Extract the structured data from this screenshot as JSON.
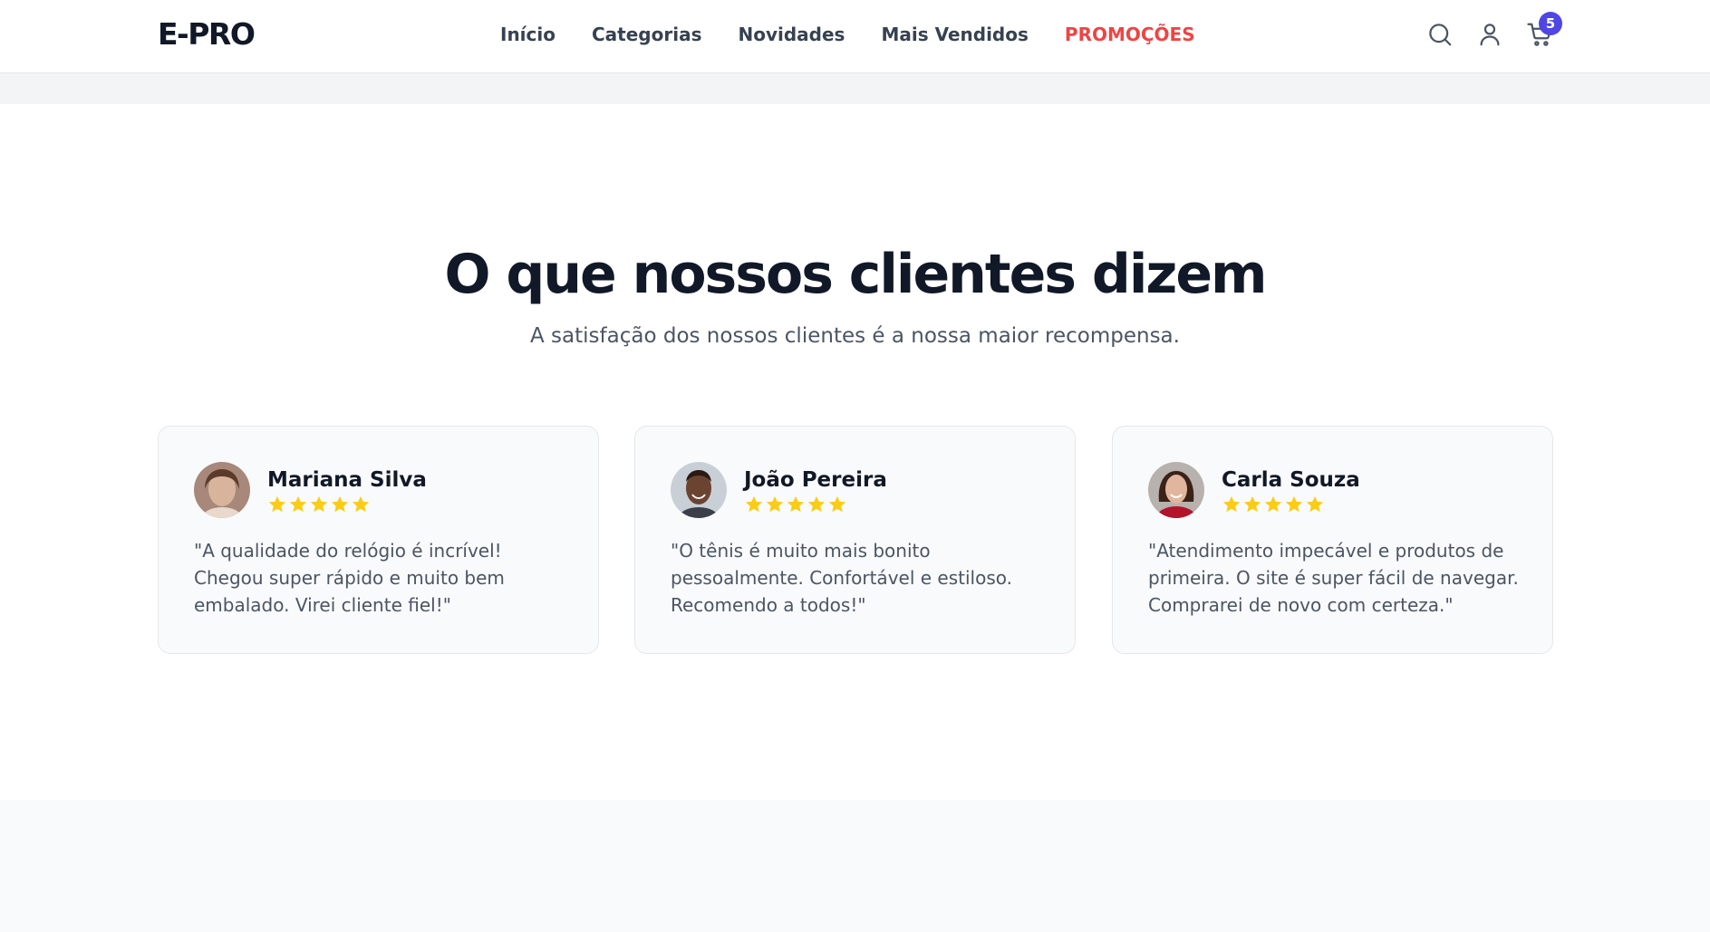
{
  "brand": {
    "logo": "E-PRO"
  },
  "nav": {
    "items": [
      {
        "label": "Início"
      },
      {
        "label": "Categorias"
      },
      {
        "label": "Novidades"
      },
      {
        "label": "Mais Vendidos"
      },
      {
        "label": "PROMOÇÕES"
      }
    ]
  },
  "header_actions": {
    "search_icon": "search-icon",
    "account_icon": "user-icon",
    "cart_icon": "cart-icon",
    "cart_count": "5"
  },
  "testimonials": {
    "title": "O que nossos clientes dizem",
    "subtitle": "A satisfação dos nossos clientes é a nossa maior recompensa.",
    "reviews": [
      {
        "name": "Mariana Silva",
        "rating": 5,
        "quote": "\"A qualidade do relógio é incrível! Chegou super rápido e muito bem embalado. Virei cliente fiel!\""
      },
      {
        "name": "João Pereira",
        "rating": 5,
        "quote": "\"O tênis é muito mais bonito pessoalmente. Confortável e estiloso. Recomendo a todos!\""
      },
      {
        "name": "Carla Souza",
        "rating": 5,
        "quote": "\"Atendimento impecável e produtos de primeira. O site é super fácil de navegar. Comprarei de novo com certeza.\""
      }
    ]
  },
  "colors": {
    "accent": "#4f46e5",
    "promo": "#ef4444",
    "star": "#facc15",
    "text_dark": "#111827",
    "text_muted": "#4b5563"
  }
}
